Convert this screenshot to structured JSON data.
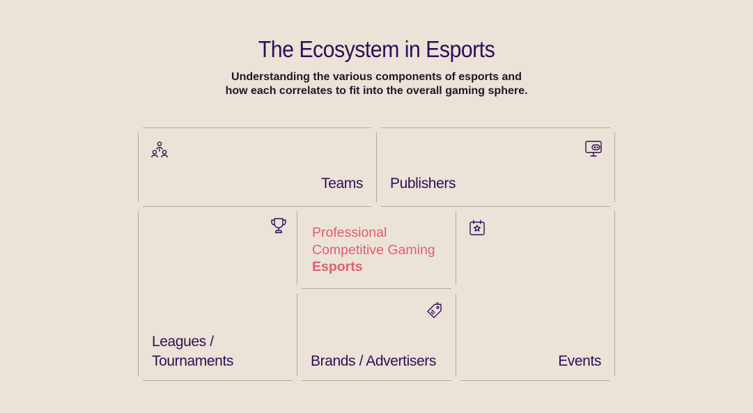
{
  "header": {
    "title": "The Ecosystem in Esports",
    "subtitle_line1": "Understanding the various components of esports and",
    "subtitle_line2": "how each correlates to fit into the overall gaming sphere."
  },
  "cells": {
    "teams": {
      "label": "Teams",
      "icon": "people-network-icon"
    },
    "publishers": {
      "label": "Publishers",
      "icon": "monitor-gamepad-icon"
    },
    "leagues": {
      "label_line1": "Leagues /",
      "label_line2": "Tournaments",
      "icon": "trophy-icon"
    },
    "center": {
      "line1": "Professional",
      "line2": "Competitive Gaming",
      "line3": "Esports"
    },
    "brands": {
      "label": "Brands / Advertisers",
      "icon": "tag-icon"
    },
    "events": {
      "label": "Events",
      "icon": "calendar-star-icon"
    }
  },
  "colors": {
    "background": "#ebe3d7",
    "primary": "#2e0d57",
    "accent": "#e25c6e",
    "lines": "#b9a996"
  }
}
